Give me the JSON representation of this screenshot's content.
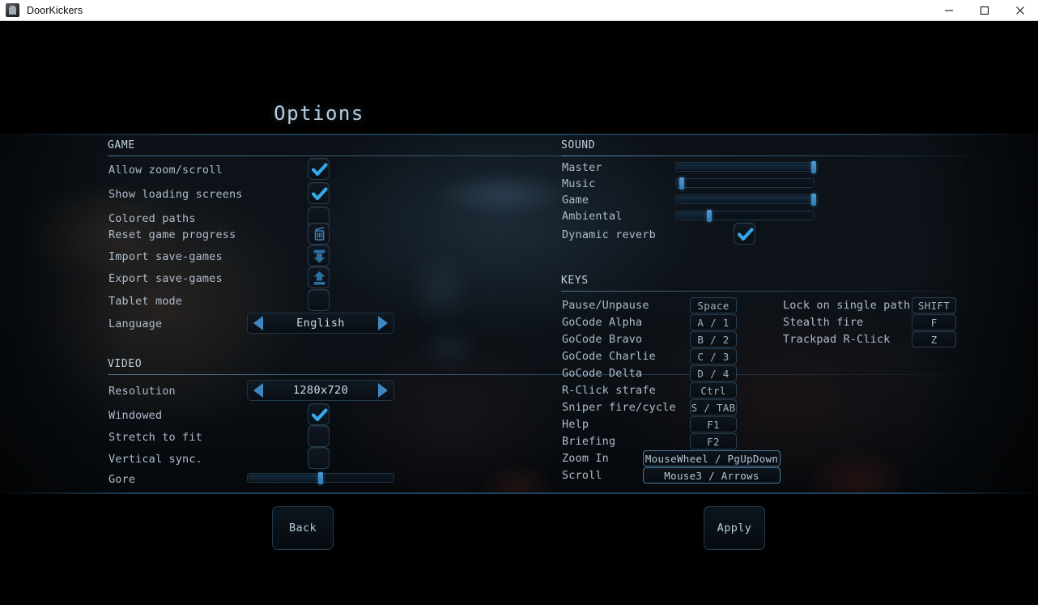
{
  "window": {
    "title": "DoorKickers",
    "icon": "app-icon",
    "controls": {
      "minimize": "minimize-icon",
      "maximize": "maximize-icon",
      "close": "close-icon"
    }
  },
  "page": {
    "title": "Options"
  },
  "colors": {
    "accent": "#3f86c0",
    "check": "#34a8e8",
    "label": "#aebccb",
    "heading": "#c3d3e1",
    "panel_bg": "#0b1117"
  },
  "sections": {
    "game": {
      "heading": "GAME",
      "rows": [
        {
          "label": "Allow zoom/scroll",
          "control": "checkbox",
          "checked": true
        },
        {
          "label": "Show loading screens",
          "control": "checkbox",
          "checked": true
        },
        {
          "label": "Colored paths",
          "control": "checkbox",
          "checked": false
        },
        {
          "label": "Reset game progress",
          "control": "icon-button",
          "icon": "trash-icon"
        },
        {
          "label": "Import save-games",
          "control": "icon-button",
          "icon": "download-arrow-icon"
        },
        {
          "label": "Export save-games",
          "control": "icon-button",
          "icon": "upload-arrow-icon"
        },
        {
          "label": "Tablet mode",
          "control": "checkbox",
          "checked": false
        },
        {
          "label": "Language",
          "control": "selector",
          "value": "English"
        }
      ]
    },
    "video": {
      "heading": "VIDEO",
      "rows": [
        {
          "label": "Resolution",
          "control": "selector",
          "value": "1280x720"
        },
        {
          "label": "Windowed",
          "control": "checkbox",
          "checked": true
        },
        {
          "label": "Stretch to fit",
          "control": "checkbox",
          "checked": false
        },
        {
          "label": "Vertical sync.",
          "control": "checkbox",
          "checked": false
        },
        {
          "label": "Gore",
          "control": "slider",
          "value": 50
        }
      ]
    },
    "sound": {
      "heading": "SOUND",
      "rows": [
        {
          "label": "Master",
          "control": "slider",
          "value": 100
        },
        {
          "label": "Music",
          "control": "slider",
          "value": 4
        },
        {
          "label": "Game",
          "control": "slider",
          "value": 100
        },
        {
          "label": "Ambiental",
          "control": "slider",
          "value": 24
        },
        {
          "label": "Dynamic reverb",
          "control": "checkbox",
          "checked": true
        }
      ]
    },
    "keys": {
      "heading": "KEYS",
      "left_column": [
        {
          "label": "Pause/Unpause",
          "key": "Space",
          "wide": false
        },
        {
          "label": "GoCode Alpha",
          "key": "A / 1",
          "wide": false
        },
        {
          "label": "GoCode Bravo",
          "key": "B / 2",
          "wide": false
        },
        {
          "label": "GoCode Charlie",
          "key": "C / 3",
          "wide": false
        },
        {
          "label": "GoCode Delta",
          "key": "D / 4",
          "wide": false
        },
        {
          "label": "R-Click strafe",
          "key": "Ctrl",
          "wide": false
        },
        {
          "label": "Sniper fire/cycle",
          "key": "S / TAB",
          "wide": false
        },
        {
          "label": "Help",
          "key": "F1",
          "wide": false
        },
        {
          "label": "Briefing",
          "key": "F2",
          "wide": false
        },
        {
          "label": "Zoom In",
          "key": "MouseWheel / PgUpDown",
          "wide": true
        },
        {
          "label": "Scroll",
          "key": "Mouse3 / Arrows",
          "wide": true
        }
      ],
      "right_column": [
        {
          "label": "Lock on single path",
          "key": "SHIFT"
        },
        {
          "label": "Stealth fire",
          "key": "F"
        },
        {
          "label": "Trackpad R-Click",
          "key": "Z"
        }
      ]
    }
  },
  "footer": {
    "back_label": "Back",
    "apply_label": "Apply"
  }
}
